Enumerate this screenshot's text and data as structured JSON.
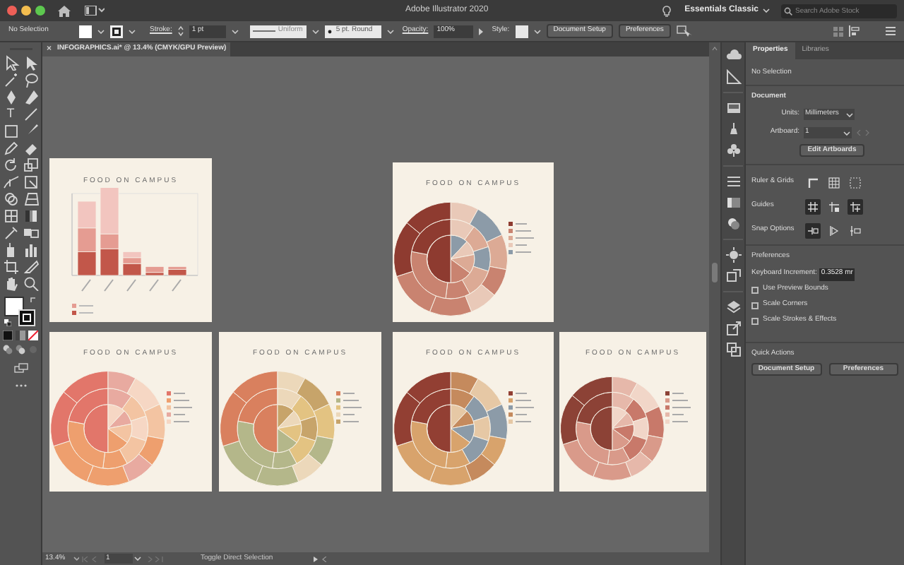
{
  "window": {
    "title": "Adobe Illustrator 2020"
  },
  "workspace": {
    "label": "Essentials Classic"
  },
  "stock_search": {
    "placeholder": "Search Adobe Stock"
  },
  "control_bar": {
    "selection": "No Selection",
    "stroke_label": "Stroke:",
    "stroke_weight": "1 pt",
    "stroke_profile": "Uniform",
    "brush": "5 pt. Round",
    "opacity_label": "Opacity:",
    "opacity": "100%",
    "style_label": "Style:",
    "buttons": [
      "Document Setup",
      "Preferences"
    ]
  },
  "document_tab": {
    "close": "×",
    "title": "INFOGRAPHICS.ai* @ 13.4% (CMYK/GPU Preview)"
  },
  "tools": {
    "type_tool": "T"
  },
  "artboards": [
    {
      "kind": "bar",
      "title": "FOOD ON CAMPUS"
    },
    {
      "kind": "sunburst",
      "title": "FOOD ON CAMPUS"
    },
    {
      "kind": "sunburst",
      "title": "FOOD ON CAMPUS"
    },
    {
      "kind": "sunburst",
      "title": "FOOD ON CAMPUS"
    },
    {
      "kind": "sunburst",
      "title": "FOOD ON CAMPUS"
    },
    {
      "kind": "sunburst",
      "title": "FOOD ON CAMPUS"
    }
  ],
  "properties_panel": {
    "tabs": [
      {
        "label": "Properties",
        "selected": true
      },
      {
        "label": "Libraries",
        "selected": false
      }
    ],
    "selection": "No Selection",
    "document_heading": "Document",
    "units_label": "Units:",
    "units": "Millimeters",
    "artboard_label": "Artboard:",
    "artboard": "1",
    "edit_button": "Edit Artboards",
    "rows": [
      {
        "label": "Ruler & Grids",
        "toggles": [
          {
            "on": false
          },
          {
            "on": false
          },
          {
            "on": false
          }
        ]
      },
      {
        "label": "Guides",
        "toggles": [
          {
            "on": true
          },
          {
            "on": false
          },
          {
            "on": true
          }
        ]
      },
      {
        "label": "Snap Options",
        "toggles": [
          {
            "on": true
          },
          {
            "on": false
          },
          {
            "on": false
          }
        ]
      }
    ],
    "preferences_heading": "Preferences",
    "keyboard_increment_label": "Keyboard Increment:",
    "keyboard_increment": "0.3528 mr",
    "checkboxes": [
      {
        "label": "Use Preview Bounds",
        "checked": false
      },
      {
        "label": "Scale Corners",
        "checked": false
      },
      {
        "label": "Scale Strokes & Effects",
        "checked": false
      }
    ],
    "quick_actions_heading": "Quick Actions",
    "quick_buttons": [
      "Document Setup",
      "Preferences"
    ]
  },
  "status_bar": {
    "zoom": "13.4%",
    "artboard": "1",
    "tool_hint": "Toggle Direct Selection"
  }
}
